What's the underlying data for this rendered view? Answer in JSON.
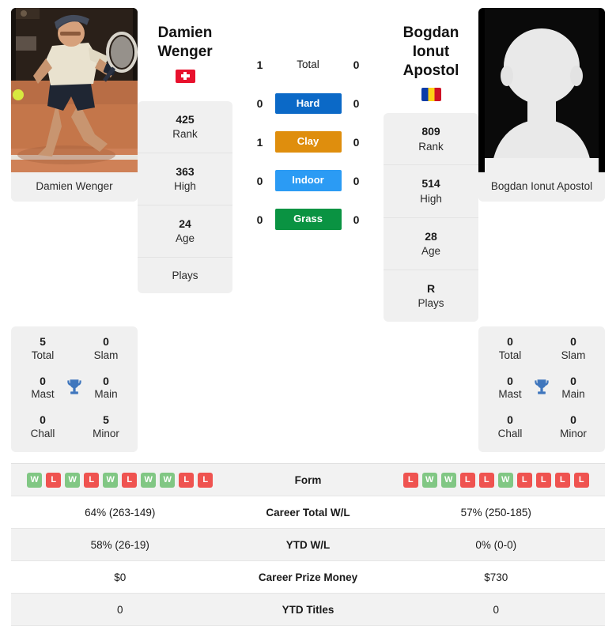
{
  "players": {
    "left": {
      "name": "Damien Wenger",
      "name_line1": "Damien",
      "name_line2": "Wenger",
      "country_code": "CH",
      "flag_icon": "swiss-flag-icon",
      "photo_caption": "Damien Wenger",
      "rank": "425",
      "rank_label": "Rank",
      "high": "363",
      "high_label": "High",
      "age": "24",
      "age_label": "Age",
      "plays": "",
      "plays_label": "Plays",
      "titles": {
        "total": "5",
        "total_label": "Total",
        "slam": "0",
        "slam_label": "Slam",
        "mast": "0",
        "mast_label": "Mast",
        "main": "0",
        "main_label": "Main",
        "chall": "0",
        "chall_label": "Chall",
        "minor": "5",
        "minor_label": "Minor"
      },
      "form": [
        "W",
        "L",
        "W",
        "L",
        "W",
        "L",
        "W",
        "W",
        "L",
        "L"
      ],
      "career_total_wl": "64% (263-149)",
      "ytd_wl": "58% (26-19)",
      "career_prize_money": "$0",
      "ytd_titles": "0"
    },
    "right": {
      "name": "Bogdan Ionut Apostol",
      "name_line1": "Bogdan Ionut",
      "name_line2": "Apostol",
      "country_code": "RO",
      "flag_icon": "romania-flag-icon",
      "photo_caption": "Bogdan Ionut Apostol",
      "rank": "809",
      "rank_label": "Rank",
      "high": "514",
      "high_label": "High",
      "age": "28",
      "age_label": "Age",
      "plays": "R",
      "plays_label": "Plays",
      "titles": {
        "total": "0",
        "total_label": "Total",
        "slam": "0",
        "slam_label": "Slam",
        "mast": "0",
        "mast_label": "Mast",
        "main": "0",
        "main_label": "Main",
        "chall": "0",
        "chall_label": "Chall",
        "minor": "0",
        "minor_label": "Minor"
      },
      "form": [
        "L",
        "W",
        "W",
        "L",
        "L",
        "W",
        "L",
        "L",
        "L",
        "L"
      ],
      "career_total_wl": "57% (250-185)",
      "ytd_wl": "0% (0-0)",
      "career_prize_money": "$730",
      "ytd_titles": "0"
    }
  },
  "head_to_head": [
    {
      "label": "Total",
      "left": "1",
      "right": "0",
      "color": "",
      "style": "plain"
    },
    {
      "label": "Hard",
      "left": "0",
      "right": "0",
      "color": "#0b69c7",
      "style": "badge"
    },
    {
      "label": "Clay",
      "left": "1",
      "right": "0",
      "color": "#df8e0d",
      "style": "badge"
    },
    {
      "label": "Indoor",
      "left": "0",
      "right": "0",
      "color": "#2b9bf4",
      "style": "badge"
    },
    {
      "label": "Grass",
      "left": "0",
      "right": "0",
      "color": "#0a9342",
      "style": "badge"
    }
  ],
  "stats_rows": [
    {
      "label": "Form",
      "key": "form",
      "type": "form"
    },
    {
      "label": "Career Total W/L",
      "key": "career_total_wl",
      "type": "text"
    },
    {
      "label": "YTD W/L",
      "key": "ytd_wl",
      "type": "text"
    },
    {
      "label": "Career Prize Money",
      "key": "career_prize_money",
      "type": "text"
    },
    {
      "label": "YTD Titles",
      "key": "ytd_titles",
      "type": "text"
    }
  ],
  "colors": {
    "win": "#81c784",
    "loss": "#ef5350",
    "hard": "#0b69c7",
    "clay": "#df8e0d",
    "indoor": "#2b9bf4",
    "grass": "#0a9342",
    "trophy": "#3f76bd",
    "panel": "#f0f0f0"
  }
}
